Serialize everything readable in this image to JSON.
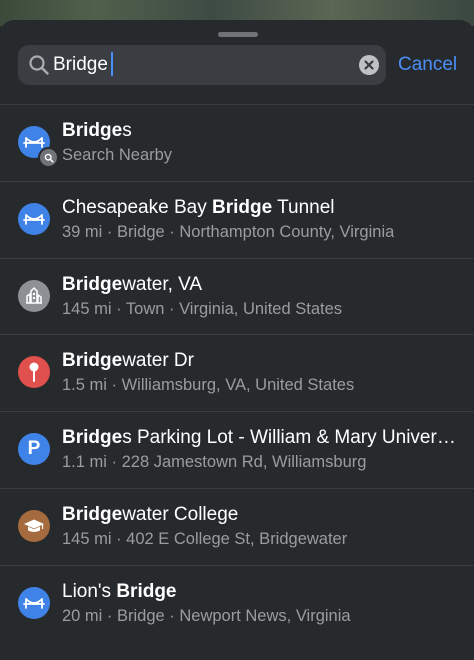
{
  "search": {
    "query": "Bridge",
    "cancel_label": "Cancel"
  },
  "colors": {
    "accent": "#4a8ff7",
    "bridge_icon": "#3f83e8",
    "town_icon": "#8d9196",
    "pin_icon": "#e0504c",
    "parking_icon": "#3f83e8",
    "college_icon": "#a56a3d"
  },
  "results": [
    {
      "match": "Bridge",
      "rest": "s",
      "subtitle": "Search Nearby",
      "icon": "bridge-icon",
      "badge": "search-icon"
    },
    {
      "pre": "Chesapeake Bay ",
      "match": "Bridge",
      "rest": " Tunnel",
      "subtitle": "39 mi · Bridge · Northampton County, Virginia",
      "icon": "bridge-icon"
    },
    {
      "match": "Bridge",
      "rest": "water, VA",
      "subtitle": "145 mi · Town · Virginia, United States",
      "icon": "town-icon"
    },
    {
      "match": "Bridge",
      "rest": "water Dr",
      "subtitle": "1.5 mi · Williamsburg, VA, United States",
      "icon": "pin-icon"
    },
    {
      "match": "Bridge",
      "rest": "s Parking Lot - William & Mary Univers…",
      "subtitle": "1.1 mi · 228 Jamestown Rd, Williamsburg",
      "icon": "parking-icon",
      "icon_letter": "P"
    },
    {
      "match": "Bridge",
      "rest": "water College",
      "subtitle": "145 mi · 402 E College St, Bridgewater",
      "icon": "graduation-cap-icon"
    },
    {
      "pre": "Lion's ",
      "match": "Bridge",
      "rest": "",
      "subtitle": "20 mi · Bridge · Newport News, Virginia",
      "icon": "bridge-icon"
    }
  ]
}
